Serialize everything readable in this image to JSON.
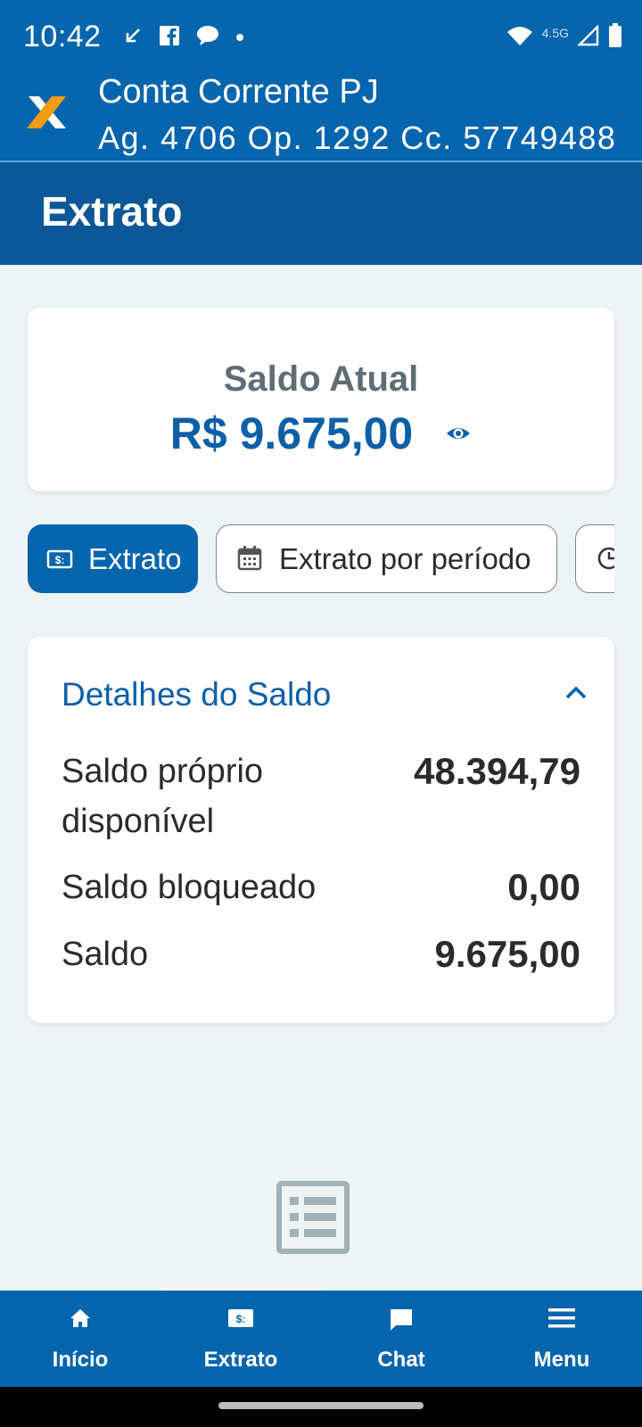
{
  "status_bar": {
    "time": "10:42",
    "network_label": "4.5G",
    "icons": [
      "missed-call-icon",
      "facebook-icon",
      "chat-bubble-icon",
      "dot-icon",
      "wifi-icon",
      "signal-icon",
      "battery-icon"
    ]
  },
  "header": {
    "title": "Conta Corrente PJ",
    "account_info": "Ag. 4706 Op. 1292 Cc. 57749488"
  },
  "page": {
    "title": "Extrato"
  },
  "balance": {
    "label": "Saldo Atual",
    "value": "R$ 9.675,00"
  },
  "chips": [
    {
      "label": "Extrato",
      "icon": "money-icon",
      "active": true
    },
    {
      "label": "Extrato por período",
      "icon": "calendar-icon",
      "active": false
    },
    {
      "label": "",
      "icon": "clock-icon",
      "active": false
    }
  ],
  "details": {
    "title": "Detalhes do Saldo",
    "rows": [
      {
        "label": "Saldo próprio disponível",
        "value": "48.394,79"
      },
      {
        "label": "Saldo bloqueado",
        "value": "0,00"
      },
      {
        "label": "Saldo",
        "value": "9.675,00"
      }
    ]
  },
  "bottom_nav": {
    "items": [
      {
        "label": "Início",
        "icon": "home-icon"
      },
      {
        "label": "Extrato",
        "icon": "money-icon",
        "active": true
      },
      {
        "label": "Chat",
        "icon": "chat-icon"
      },
      {
        "label": "Menu",
        "icon": "menu-icon"
      }
    ]
  },
  "colors": {
    "primary": "#0565ad",
    "title_bar": "#0b5797",
    "accent_text": "#0d5fa8",
    "background": "#eef3f4",
    "logo_orange": "#f39c12"
  }
}
